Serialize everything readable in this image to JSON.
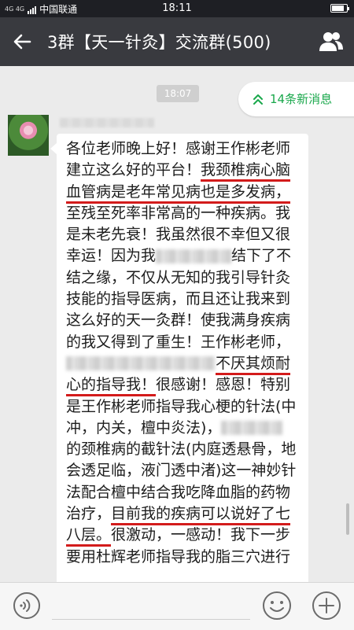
{
  "status_bar": {
    "network": "4G 4G",
    "carrier": "中国联通",
    "time": "18:11"
  },
  "header": {
    "title": "3群【天一针灸】交流群(500)"
  },
  "chat": {
    "timestamp": "18:07",
    "new_messages": "14条新消息",
    "message_lines": [
      [
        "各位老师晚上好！感谢王作彬老师"
      ],
      [
        "建立这么好的平台！",
        "我颈椎病心脑"
      ],
      [
        "血管病是老年常见病也是多发病，"
      ],
      [
        "至残至死率非常高的一种疾病。我"
      ],
      [
        "是未老先衰！我虽然很不幸但又很"
      ],
      [
        "幸运！因为我",
        "结下了不"
      ],
      [
        "结之缘，不仅从无知的我引导针灸"
      ],
      [
        "技能的指导医病，而且还让我来到"
      ],
      [
        "这么好的天一灸群！使我满身疾病"
      ],
      [
        "的我又得到了重生！王作彬老师，"
      ],
      [
        "不厌其烦耐"
      ],
      [
        "心的指导我！",
        "很感谢！感恩！特别"
      ],
      [
        "是王作彬老师指导我心梗的针法(中"
      ],
      [
        "冲，内关，檀中炎法)，"
      ],
      [
        "的颈椎病的截针法(内庭透悬骨，地"
      ],
      [
        "会透足临，液门透中渚)这一神妙针"
      ],
      [
        "法配合檀中结合我吃降血脂的药物"
      ],
      [
        "治疗，",
        "目前我的疾病可以说好了七"
      ],
      [
        "八层。",
        "很激动，一感动！我下一步"
      ],
      [
        "要用杜辉老师指导我的脂三穴进行"
      ]
    ]
  },
  "icons": {
    "back": "back-arrow-icon",
    "group_info": "people-icon",
    "new_messages": "double-chevron-up-icon",
    "voice": "voice-icon",
    "emoji": "emoji-icon",
    "more": "plus-icon"
  },
  "colors": {
    "header_bg": "#393a3f",
    "status_bar_bg": "#1e1f24",
    "chat_bg": "#ebebeb",
    "accent_green": "#1aa84c",
    "underline_red": "#d31b1b"
  }
}
